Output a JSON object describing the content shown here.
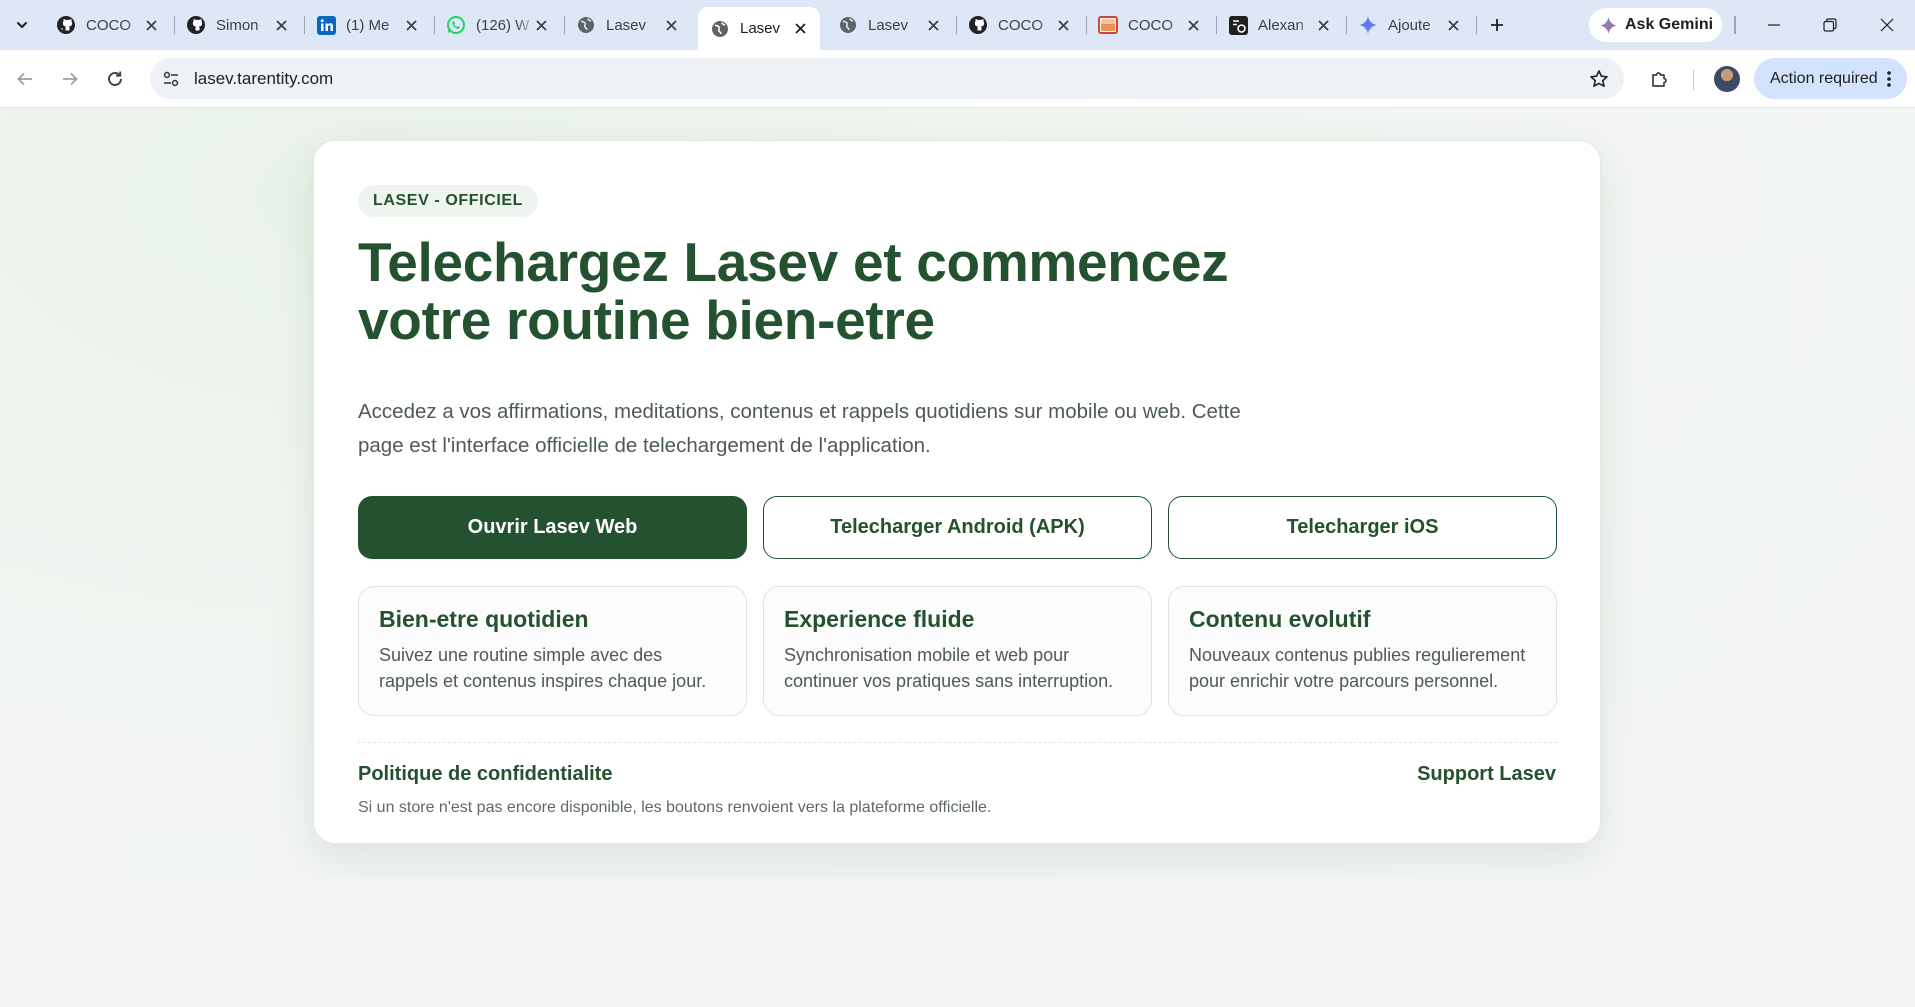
{
  "browser": {
    "tabs": [
      {
        "title": "COCO",
        "icon": "github-icon",
        "active": false
      },
      {
        "title": "Simon",
        "icon": "github-icon",
        "active": false
      },
      {
        "title": "(1) Me",
        "icon": "linkedin-icon",
        "active": false
      },
      {
        "title": "(126) W",
        "icon": "whatsapp-icon",
        "active": false
      },
      {
        "title": "Lasev",
        "icon": "globe-icon",
        "active": false
      },
      {
        "title": "Lasev",
        "icon": "globe-icon",
        "active": true
      },
      {
        "title": "Lasev",
        "icon": "globe-icon",
        "active": false
      },
      {
        "title": "COCO",
        "icon": "github-icon",
        "active": false
      },
      {
        "title": "COCO",
        "icon": "coco-icon",
        "active": false
      },
      {
        "title": "Alexan",
        "icon": "app-icon",
        "active": false
      },
      {
        "title": "Ajoute",
        "icon": "gemini-icon",
        "active": false
      }
    ],
    "gemini_label": "Ask Gemini",
    "url": "lasev.tarentity.com",
    "action_label": "Action required"
  },
  "page": {
    "badge": "LASEV - OFFICIEL",
    "title": "Telechargez Lasev et commencez votre routine bien-etre",
    "subtitle": "Accedez a vos affirmations, meditations, contenus et rappels quotidiens sur mobile ou web. Cette page est l'interface officielle de telechargement de l'application.",
    "buttons": {
      "web": "Ouvrir Lasev Web",
      "android": "Telecharger Android (APK)",
      "ios": "Telecharger iOS"
    },
    "features": [
      {
        "title": "Bien-etre quotidien",
        "text": "Suivez une routine simple avec des rappels et contenus inspires chaque jour."
      },
      {
        "title": "Experience fluide",
        "text": "Synchronisation mobile et web pour continuer vos pratiques sans interruption."
      },
      {
        "title": "Contenu evolutif",
        "text": "Nouveaux contenus publies regulierement pour enrichir votre parcours personnel."
      }
    ],
    "footer": {
      "privacy": "Politique de confidentialite",
      "support": "Support Lasev",
      "note": "Si un store n'est pas encore disponible, les boutons renvoient vers la plateforme officielle."
    }
  },
  "colors": {
    "brand_green": "#24512f",
    "tabstrip": "#dde7f6",
    "action_chip": "#d3e3fd"
  }
}
